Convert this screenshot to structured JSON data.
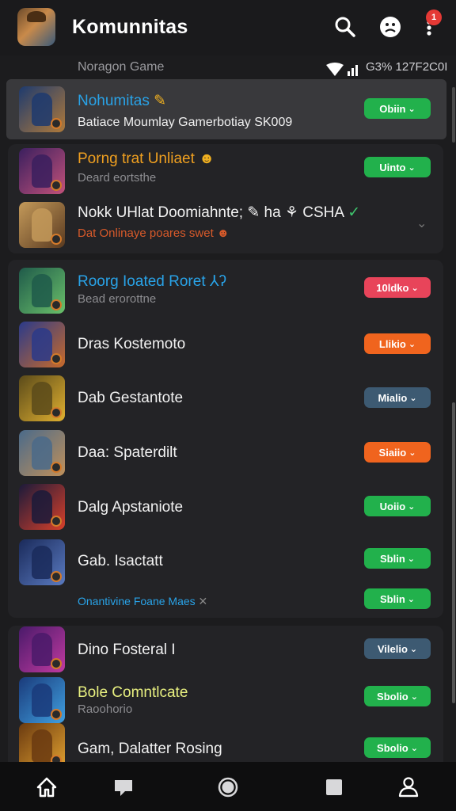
{
  "header": {
    "title": "Komunnitas",
    "notification_count": "1",
    "icons": [
      "search-icon",
      "face-icon",
      "more-vert-icon"
    ]
  },
  "statusline": {
    "left": "Noragon Game",
    "right": "G3% 127F2C0I"
  },
  "rows": [
    {
      "title": "Nohumitas",
      "title_color": "#29a3e8",
      "title_suffix": "✎",
      "subtitle": "Batiace Moumlay Gamerbotiay SK009",
      "button": "Obiin",
      "button_color": "#22b14c",
      "thumb_colors": [
        "#1d3a6e",
        "#b07a3a"
      ]
    },
    {
      "title": "Porng trat Unliaet",
      "title_color": "#f0a020",
      "title_suffix": "☻",
      "subtitle": "Deard eortsthe",
      "button": "Uinto",
      "button_color": "#22b14c",
      "thumb_colors": [
        "#3a1f5e",
        "#c2517a"
      ]
    },
    {
      "title": "Nokk UHlat Doomiahnte; ✎ ha ⚘ CSHA",
      "title_color": "#f2f2f2",
      "title_suffix": "✓",
      "subtitle": "Dat Onlinaye poares swet ☻",
      "subtitle_color": "#d85a2a",
      "button": "",
      "button_color": "",
      "thumb_colors": [
        "#c49a5a",
        "#5a3a20"
      ]
    },
    {
      "title": "Roorg Ioated Roret ⅄ʔ",
      "title_color": "#29a3e8",
      "title_suffix": "",
      "subtitle": "Bead erorottne",
      "button": "10ldko",
      "button_color": "#e8445a",
      "thumb_colors": [
        "#1f5a4a",
        "#6ac06a"
      ]
    },
    {
      "title": "Dras Kostemoto",
      "title_color": "#f2f2f2",
      "title_suffix": "",
      "subtitle": "",
      "button": "Llikio",
      "button_color": "#f0641e",
      "thumb_colors": [
        "#2a3a8a",
        "#c86a2a"
      ]
    },
    {
      "title": "Dab Gestantote",
      "title_color": "#f2f2f2",
      "title_suffix": "",
      "subtitle": "",
      "button": "Mialio",
      "button_color": "#3d5a72",
      "thumb_colors": [
        "#5a4a1a",
        "#e0b030"
      ]
    },
    {
      "title": "Daa: Spaterdilt",
      "title_color": "#f2f2f2",
      "title_suffix": "",
      "subtitle": "",
      "button": "Siaiio",
      "button_color": "#f0641e",
      "thumb_colors": [
        "#4a6a8a",
        "#c0905a"
      ]
    },
    {
      "title": "Dalg Apstaniote",
      "title_color": "#f2f2f2",
      "title_suffix": "",
      "subtitle": "",
      "button": "Uoiio",
      "button_color": "#22b14c",
      "thumb_colors": [
        "#1a1a3a",
        "#d8402a"
      ]
    },
    {
      "title": "Gab. Isactatt",
      "title_color": "#f2f2f2",
      "title_suffix": "",
      "subtitle": "",
      "button": "Sblin",
      "button_color": "#22b14c",
      "thumb_colors": [
        "#1a2a5a",
        "#5a7ac0"
      ]
    },
    {
      "title": "Onantivine Foane Maes",
      "title_color": "#29a3e8",
      "title_suffix": "✕",
      "subtitle": "",
      "button": "Sblin",
      "button_color": "#22b14c",
      "thumb_colors": []
    },
    {
      "title": "Dino Fosteral I",
      "title_color": "#f2f2f2",
      "title_suffix": "",
      "subtitle": "",
      "button": "Vilelio",
      "button_color": "#3d5a72",
      "thumb_colors": [
        "#4a1a6a",
        "#c03aa0"
      ]
    },
    {
      "title": "Bole Comntlcate",
      "title_color": "#e8f080",
      "title_suffix": "",
      "subtitle": "Raoohorio",
      "button": "Sbolio",
      "button_color": "#22b14c",
      "thumb_colors": [
        "#1a3a7a",
        "#40a0e0"
      ]
    },
    {
      "title": "Gam, Dalatter Rosing",
      "title_color": "#f2f2f2",
      "title_suffix": "",
      "subtitle": "",
      "button": "Sbolio",
      "button_color": "#22b14c",
      "thumb_colors": [
        "#6a3a10",
        "#e0a030"
      ]
    }
  ],
  "bottom_nav": [
    "home-icon",
    "chat-icon",
    "circle-icon",
    "square-icon",
    "profile-icon"
  ]
}
